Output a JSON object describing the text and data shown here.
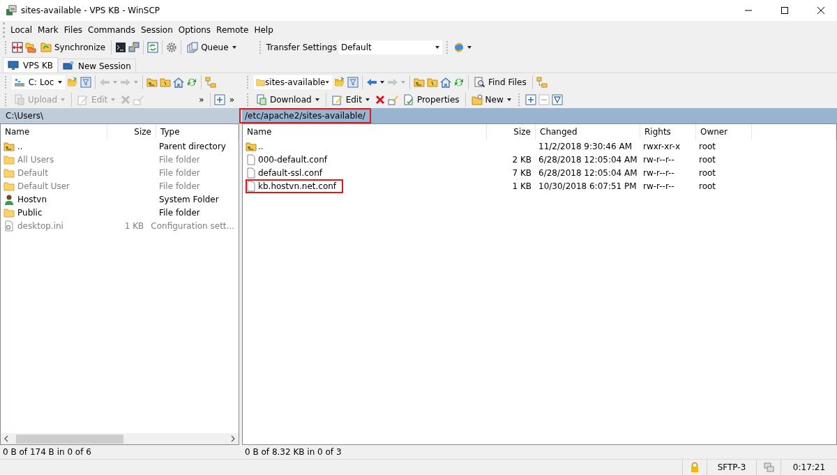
{
  "window": {
    "title": "sites-available - VPS KB - WinSCP"
  },
  "menu": [
    "Local",
    "Mark",
    "Files",
    "Commands",
    "Session",
    "Options",
    "Remote",
    "Help"
  ],
  "toolbar": {
    "synchronize": "Synchronize",
    "queue": "Queue",
    "transfer_label": "Transfer Settings",
    "transfer_value": "Default"
  },
  "tabs": [
    {
      "label": "VPS KB",
      "selected": true
    },
    {
      "label": "New Session",
      "selected": false
    }
  ],
  "local": {
    "drive": "C: Loc",
    "more": [
      "»",
      "»"
    ],
    "buttons": [
      {
        "label": "Upload",
        "disabled": true
      },
      {
        "label": "Edit",
        "disabled": true
      }
    ],
    "path": "C:\\Users\\",
    "columns": [
      "Name",
      "Size",
      "Type"
    ],
    "rows": [
      {
        "kind": "parent",
        "name": "..",
        "size": "",
        "type": "Parent directory",
        "dimmed": false
      },
      {
        "kind": "folder",
        "name": "All Users",
        "size": "",
        "type": "File folder",
        "dimmed": true
      },
      {
        "kind": "folder",
        "name": "Default",
        "size": "",
        "type": "File folder",
        "dimmed": true
      },
      {
        "kind": "folder",
        "name": "Default User",
        "size": "",
        "type": "File folder",
        "dimmed": true
      },
      {
        "kind": "user",
        "name": "Hostvn",
        "size": "",
        "type": "System Folder",
        "dimmed": false
      },
      {
        "kind": "folder",
        "name": "Public",
        "size": "",
        "type": "File folder",
        "dimmed": false
      },
      {
        "kind": "config",
        "name": "desktop.ini",
        "size": "1 KB",
        "type": "Configuration sett...",
        "dimmed": true
      }
    ],
    "summary": "0 B of 174 B in 0 of 6"
  },
  "remote": {
    "folder": "sites-available",
    "find": "Find Files",
    "buttons": [
      {
        "label": "Download",
        "disabled": false
      },
      {
        "label": "Edit",
        "disabled": false
      },
      {
        "label": "Properties",
        "disabled": false
      },
      {
        "label": "New",
        "disabled": false
      }
    ],
    "path": "/etc/apache2/sites-available/",
    "path_highlighted": true,
    "columns": [
      "Name",
      "Size",
      "Changed",
      "Rights",
      "Owner"
    ],
    "rows": [
      {
        "kind": "parent",
        "name": "..",
        "size": "",
        "changed": "11/2/2018 9:30:46 AM",
        "rights": "rwxr-xr-x",
        "owner": "root",
        "highlighted": false
      },
      {
        "kind": "file",
        "name": "000-default.conf",
        "size": "2 KB",
        "changed": "6/28/2018 12:05:04 AM",
        "rights": "rw-r--r--",
        "owner": "root",
        "highlighted": false
      },
      {
        "kind": "file",
        "name": "default-ssl.conf",
        "size": "7 KB",
        "changed": "6/28/2018 12:05:04 AM",
        "rights": "rw-r--r--",
        "owner": "root",
        "highlighted": false
      },
      {
        "kind": "file",
        "name": "kb.hostvn.net.conf",
        "size": "1 KB",
        "changed": "10/30/2018 6:07:51 PM",
        "rights": "rw-r--r--",
        "owner": "root",
        "highlighted": true
      }
    ],
    "summary": "0 B of 8.32 KB in 0 of 3"
  },
  "status_bar": {
    "protocol": "SFTP-3",
    "time": "0:17:21"
  }
}
